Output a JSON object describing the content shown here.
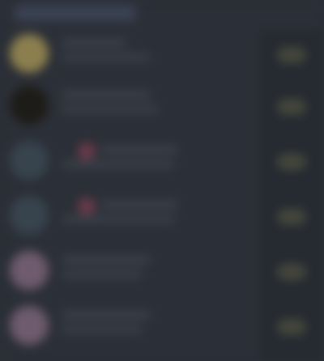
{
  "header": {
    "title": ""
  },
  "list": {
    "items": [
      {
        "name": "",
        "subtitle": "",
        "avatar_color": "#8c7f4e",
        "action_label": ""
      },
      {
        "name": "",
        "subtitle": "",
        "avatar_color": "#1d1c18",
        "action_label": ""
      },
      {
        "name": "",
        "subtitle": "",
        "avatar_color": "#37434d",
        "action_label": ""
      },
      {
        "name": "",
        "subtitle": "",
        "avatar_color": "#37434d",
        "action_label": ""
      },
      {
        "name": "",
        "subtitle": "",
        "avatar_color": "#6e5b6e",
        "action_label": ""
      },
      {
        "name": "",
        "subtitle": "",
        "avatar_color": "#6e5b6e",
        "action_label": ""
      }
    ]
  },
  "colors": {
    "background": "#2b2f37",
    "side_column": "#262a31",
    "header_pill": "#3a4252",
    "accent_pink": "#6a3a4a",
    "action_button": "#45473c"
  }
}
